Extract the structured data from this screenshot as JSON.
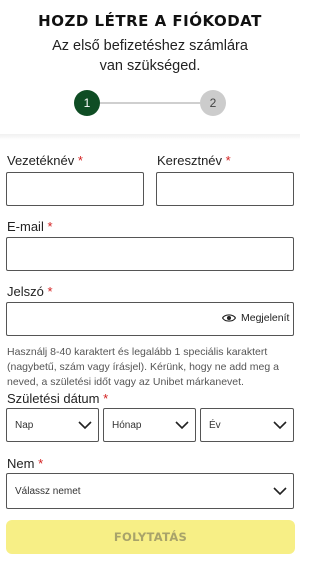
{
  "header": {
    "title": "HOZD LÉTRE A FIÓKODAT",
    "subtitle": "Az első befizetéshez számlára van szükséged."
  },
  "stepper": {
    "step1": "1",
    "step2": "2",
    "active_color": "#0f4d24",
    "inactive_color": "#cccccc"
  },
  "form": {
    "last_name_label": "Vezetéknév",
    "first_name_label": "Keresztnév",
    "email_label": "E-mail",
    "password_label": "Jelszó",
    "password_toggle": "Megjelenít",
    "password_help": "Használj 8-40 karaktert és legalább 1 speciális karaktert (nagybetű, szám vagy írásjel). Kérünk, hogy ne add meg a neved, a születési időt vagy az Unibet márkanevet.",
    "birthdate_label": "Születési dátum",
    "day_placeholder": "Nap",
    "month_placeholder": "Hónap",
    "year_placeholder": "Év",
    "gender_label": "Nem",
    "gender_placeholder": "Válassz nemet",
    "required_mark": "*"
  },
  "cta": {
    "label": "FOLYTATÁS",
    "background": "#f7ef86"
  }
}
